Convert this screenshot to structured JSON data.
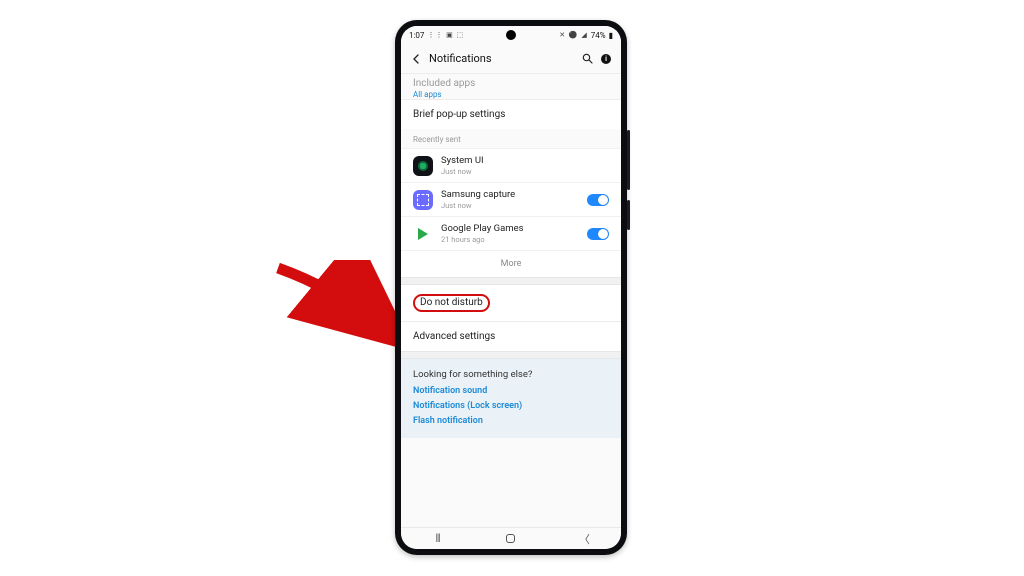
{
  "status": {
    "time": "1:07",
    "left_icons": "⋮⋮ ▣ ⬚",
    "right_icons": "✕ ⚫ ◢",
    "battery": "74%"
  },
  "header": {
    "title": "Notifications"
  },
  "faded": {
    "title": "Included apps",
    "sub": "All apps"
  },
  "rows": {
    "brief": "Brief pop-up settings",
    "dnd": "Do not disturb",
    "advanced": "Advanced settings"
  },
  "recent_label": "Recently sent",
  "apps": [
    {
      "name": "System UI",
      "sub": "Just now",
      "toggle": false
    },
    {
      "name": "Samsung capture",
      "sub": "Just now",
      "toggle": true
    },
    {
      "name": "Google Play Games",
      "sub": "21 hours ago",
      "toggle": true
    }
  ],
  "more": "More",
  "footer": {
    "title": "Looking for something else?",
    "links": [
      "Notification sound",
      "Notifications (Lock screen)",
      "Flash notification"
    ]
  },
  "info_glyph": "i"
}
